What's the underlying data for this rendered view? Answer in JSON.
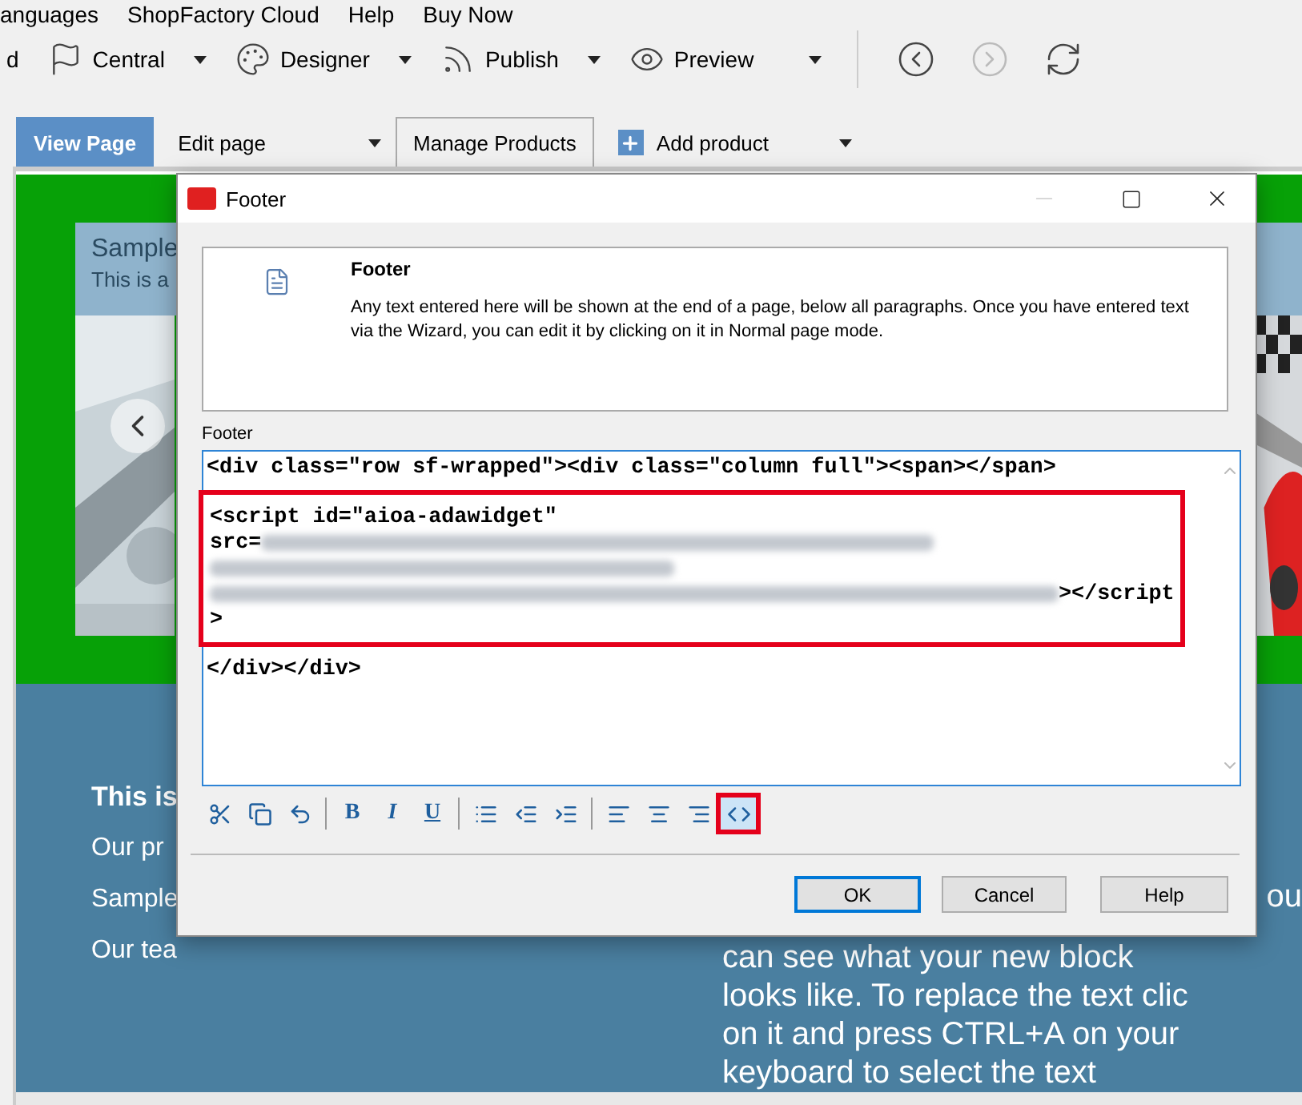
{
  "menu": [
    {
      "label": "anguages"
    },
    {
      "label": "ShopFactory Cloud"
    },
    {
      "label": "Help"
    },
    {
      "label": "Buy Now"
    }
  ],
  "toolbar": {
    "items": [
      {
        "label": "d",
        "dropdown": false
      },
      {
        "label": "Central",
        "dropdown": true
      },
      {
        "label": "Designer",
        "dropdown": true
      },
      {
        "label": "Publish",
        "dropdown": true
      },
      {
        "label": "Preview",
        "dropdown": true
      }
    ],
    "nav": [
      {
        "disabled": false
      },
      {
        "disabled": true
      },
      {
        "disabled": false
      }
    ]
  },
  "tabs": [
    {
      "label": "View Page",
      "selected": true,
      "dropdown": false,
      "kind": "tab"
    },
    {
      "label": "Edit page",
      "selected": false,
      "dropdown": true,
      "kind": "menu"
    },
    {
      "label": "Manage Products",
      "selected": false,
      "dropdown": false,
      "kind": "tab"
    },
    {
      "label": "Add product",
      "selected": false,
      "dropdown": true,
      "kind": "add"
    }
  ],
  "page": {
    "hero": {
      "title": "Sample",
      "subtitle": "This is a"
    },
    "left_texts": [
      {
        "text": "This is",
        "bold": true
      },
      {
        "text": "Our pr",
        "bold": false
      },
      {
        "text": "Sample",
        "bold": false
      },
      {
        "text": "Our tea",
        "bold": false
      }
    ],
    "right_text": {
      "fragment": "ou",
      "lines": [
        "can see what your new block",
        "looks like. To replace the text clic",
        "on it and press CTRL+A on your",
        "keyboard to select the text"
      ]
    }
  },
  "dialog": {
    "title": "Footer",
    "window_controls": [
      {
        "disabled": true
      },
      {
        "disabled": false
      },
      {
        "disabled": false
      }
    ],
    "info": {
      "title": "Footer",
      "description": "Any text entered here will be shown at the end of a page, below all paragraphs. Once you have entered text via the Wizard, you can edit it by clicking on it in Normal page mode."
    },
    "field_label": "Footer",
    "editor": {
      "before": [
        {
          "parts": [
            {
              "kind": "text",
              "text": "<div class=\"row sf-wrapped\"><div class=\"column full\"><span></span>"
            }
          ]
        }
      ],
      "highlighted": [
        {
          "parts": [
            {
              "kind": "text",
              "text": "<script id=\"aioa-adawidget\""
            }
          ]
        },
        {
          "parts": [
            {
              "kind": "text",
              "text": "src="
            },
            {
              "kind": "blur-long"
            }
          ]
        },
        {
          "parts": [
            {
              "kind": "blur-medium"
            }
          ]
        },
        {
          "parts": [
            {
              "kind": "blur-wide"
            },
            {
              "kind": "text",
              "text": "></script"
            }
          ]
        },
        {
          "parts": [
            {
              "kind": "text",
              "text": ">"
            }
          ]
        }
      ],
      "after": [
        {
          "parts": [
            {
              "kind": "text",
              "text": "</div></div>"
            }
          ]
        }
      ]
    },
    "format_toolbar": [
      {
        "kind": "button",
        "selected": false
      },
      {
        "kind": "button",
        "selected": false
      },
      {
        "kind": "button",
        "selected": false
      },
      {
        "kind": "separator"
      },
      {
        "kind": "button",
        "label": "B",
        "selected": false
      },
      {
        "kind": "button",
        "label": "I",
        "selected": false
      },
      {
        "kind": "button",
        "label": "U",
        "selected": false
      },
      {
        "kind": "separator"
      },
      {
        "kind": "button",
        "selected": false
      },
      {
        "kind": "button",
        "selected": false
      },
      {
        "kind": "button",
        "selected": false
      },
      {
        "kind": "separator"
      },
      {
        "kind": "button",
        "selected": false
      },
      {
        "kind": "button",
        "selected": false
      },
      {
        "kind": "button",
        "selected": false
      },
      {
        "kind": "button",
        "selected": true
      }
    ],
    "buttons": [
      {
        "label": "OK",
        "default": true
      },
      {
        "label": "Cancel",
        "default": false
      },
      {
        "label": "Help",
        "default": false
      }
    ]
  }
}
